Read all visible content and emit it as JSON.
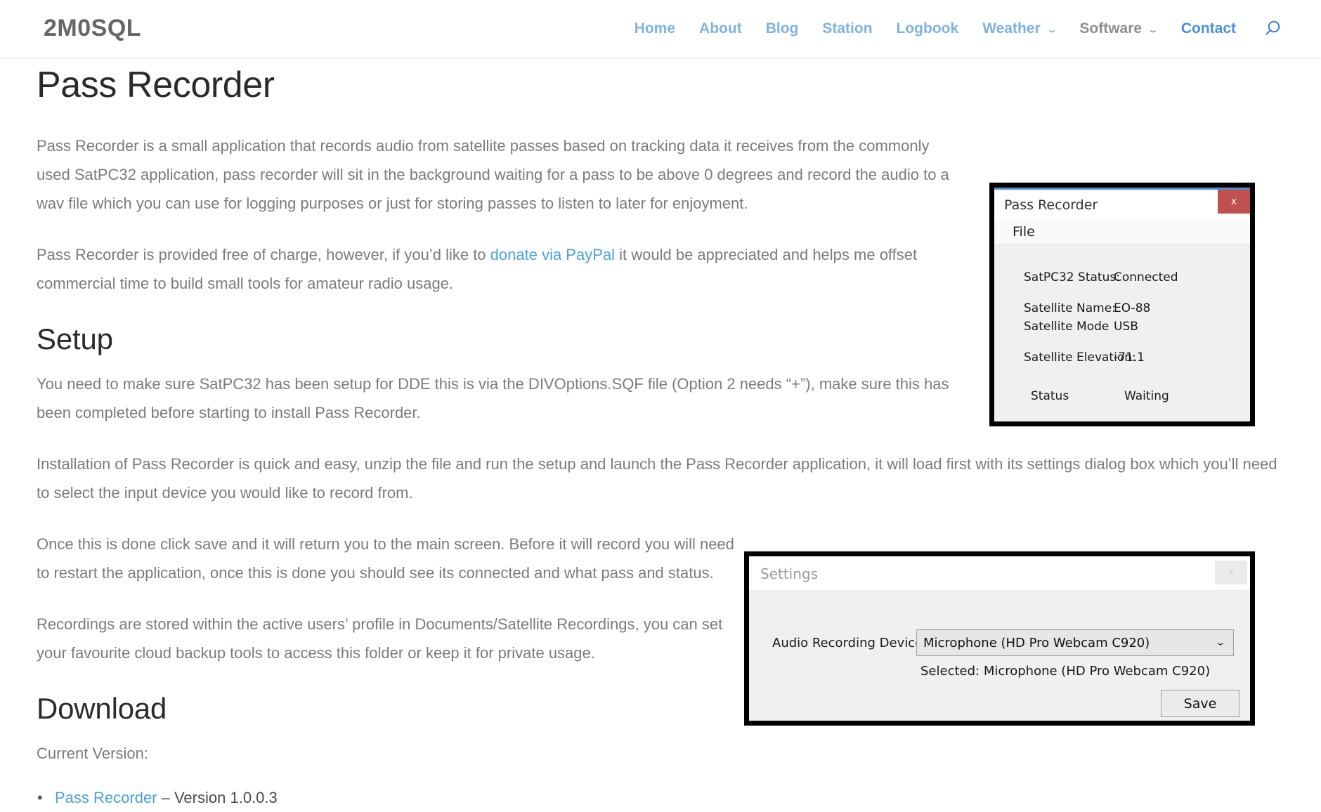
{
  "site": {
    "logo": "2M0SQL",
    "nav": [
      {
        "label": "Home",
        "icon": null,
        "state": "link"
      },
      {
        "label": "About",
        "icon": null,
        "state": "link"
      },
      {
        "label": "Blog",
        "icon": null,
        "state": "link"
      },
      {
        "label": "Station",
        "icon": null,
        "state": "link"
      },
      {
        "label": "Logbook",
        "icon": null,
        "state": "link"
      },
      {
        "label": "Weather",
        "icon": "chevron-down",
        "state": "link"
      },
      {
        "label": "Software",
        "icon": "chevron-down",
        "state": "current"
      },
      {
        "label": "Contact",
        "icon": null,
        "state": "link"
      }
    ],
    "search_icon": "search-icon",
    "chevron_glyph": "⌄"
  },
  "page": {
    "title": "Pass Recorder",
    "paragraphs": {
      "intro_pre_link": "Pass Recorder is a small application that records audio from satellite passes based on tracking data it receives from the commonly used SatPC32 application, pass recorder will sit in the background waiting for a pass to be above 0 degrees and record the audio to a wav file which you can use for logging purposes or just for storing passes to listen to later for enjoyment.",
      "donate_pre": "Pass Recorder is provided free of charge, however, if you’d like to ",
      "donate_link": "donate via PayPal",
      "donate_post": " it would be appreciated and helps me offset commercial time to build small tools for amateur radio usage.",
      "setup_1": "You need to make sure SatPC32 has been setup for DDE this is via the DIVOptions.SQF file (Option 2 needs “+”), make sure this has been completed before starting to install Pass Recorder.",
      "setup_2": "Installation of Pass Recorder is quick and easy, unzip the file and run the setup and launch the Pass Recorder application, it will load first with its settings dialog box which you’ll need to select the input device you would like to record from.",
      "setup_3": "Once this is done click save and it will return you to the main screen. Before it will record you will need to restart the application, once this is done you should see its connected and what pass and status.",
      "setup_4": "Recordings are stored within the active users’ profile in Documents/Satellite Recordings, you can set your favourite cloud backup tools to access this folder or keep it for private usage."
    },
    "headings": {
      "setup": "Setup",
      "download": "Download"
    },
    "download": {
      "current_version_label": "Current Version:",
      "items": [
        {
          "link": "Pass Recorder",
          "suffix": " – Version 1.0.0.3"
        }
      ]
    }
  },
  "pass_recorder_window": {
    "title": "Pass Recorder",
    "close_label": "x",
    "menu": [
      "File"
    ],
    "fields": [
      {
        "label": "SatPC32 Status:",
        "value": "Connected"
      },
      {
        "label": "Satellite Name:",
        "value": "EO-88"
      },
      {
        "label": "Satellite Mode",
        "value": "USB"
      },
      {
        "label": "Satellite Elevation:",
        "value": "-71.1"
      },
      {
        "label": "Status",
        "value": "Waiting"
      }
    ],
    "accent_color": "#4a8fc9",
    "close_color": "#c0504d"
  },
  "settings_window": {
    "title": "Settings",
    "close_label": "x",
    "device_label": "Audio Recording Device:",
    "device_value": "Microphone (HD Pro Webcam C920)",
    "selected_text": "Selected: Microphone (HD Pro Webcam C920)",
    "save_label": "Save",
    "dropdown_arrow": "⌄"
  }
}
